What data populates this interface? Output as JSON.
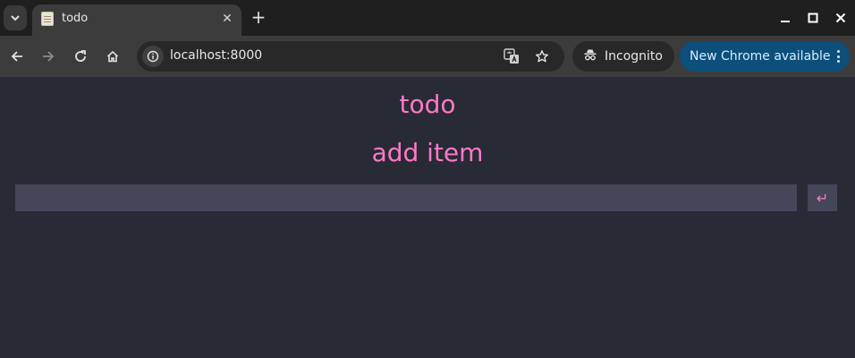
{
  "browser": {
    "tab_title": "todo",
    "url": "localhost:8000",
    "incognito_label": "Incognito",
    "update_label": "New Chrome available",
    "new_tab_symbol": "+",
    "tab_close_symbol": "✕"
  },
  "app": {
    "title": "todo",
    "section_title": "add item",
    "input_value": "",
    "submit_symbol": "↵"
  },
  "colors": {
    "page_background": "#282a36",
    "accent": "#ff79c6",
    "input_background": "#44475a",
    "update_pill": "#0b4f7a"
  },
  "icons": [
    "tab-search-icon",
    "favicon-icon",
    "close-icon",
    "new-tab-icon",
    "minimize-icon",
    "maximize-icon",
    "window-close-icon",
    "back-icon",
    "forward-icon",
    "reload-icon",
    "home-icon",
    "site-info-icon",
    "translate-icon",
    "star-icon",
    "incognito-icon",
    "more-vert-icon"
  ]
}
